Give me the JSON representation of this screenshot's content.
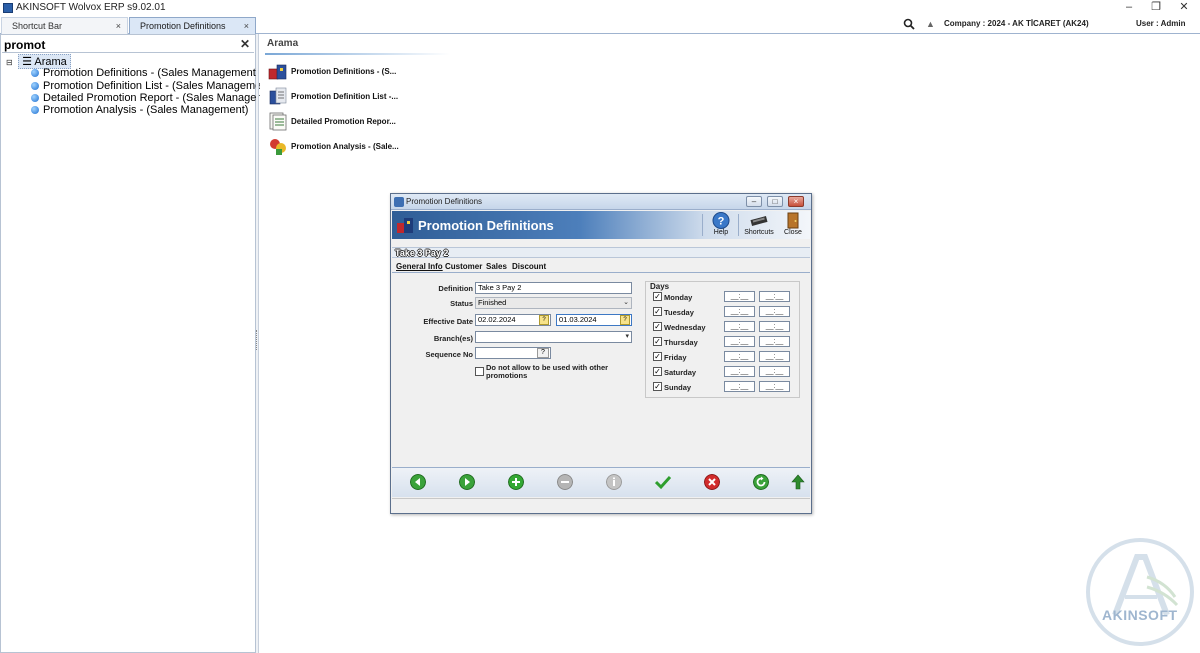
{
  "window": {
    "title": "AKINSOFT Wolvox ERP s9.02.01",
    "minimize": "–",
    "restore": "❐",
    "close": "✕"
  },
  "tabs": [
    {
      "label": "Shortcut Bar",
      "close": "×"
    },
    {
      "label": "Promotion Definitions",
      "close": "×"
    }
  ],
  "topbar": {
    "company": "Company : 2024 - AK TİCARET (AK24)",
    "user": "User : Admin",
    "bell": "▲"
  },
  "left_pane": {
    "search_value": "promot",
    "clear": "✕",
    "tree_root": "Arama",
    "expander": "⊟",
    "items": [
      "Promotion Definitions - (Sales Management)",
      "Promotion Definition List - (Sales Management)",
      "Detailed Promotion Report - (Sales Management)",
      "Promotion Analysis - (Sales Management)"
    ]
  },
  "results": {
    "header": "Arama",
    "items": [
      "Promotion Definitions - (S...",
      "Promotion Definition List -...",
      "Detailed Promotion Repor...",
      "Promotion Analysis - (Sale..."
    ]
  },
  "dialog": {
    "title": "Promotion Definitions",
    "banner_title": "Promotion Definitions",
    "toolbar": {
      "help": "Help",
      "shortcuts": "Shortcuts",
      "close": "Close"
    },
    "record_title": "Take 3 Pay 2",
    "tabs": [
      "General Info",
      "Customer",
      "Sales",
      "Discount"
    ],
    "form": {
      "definition_label": "Definition",
      "definition_value": "Take 3 Pay 2",
      "status_label": "Status",
      "status_value": "Finished",
      "effective_date_label": "Effective Date",
      "date_start": "02.02.2024",
      "date_end": "01.03.2024",
      "branches_label": "Branch(es)",
      "branches_value": "",
      "sequence_label": "Sequence No",
      "sequence_value": "",
      "sequence_btn": "?",
      "no_other_promotions_label": "Do not allow to be used with other promotions",
      "no_other_promotions_checked": false
    },
    "days": {
      "title": "Days",
      "time_placeholder": "__:__",
      "items": [
        {
          "label": "Monday",
          "checked": true
        },
        {
          "label": "Tuesday",
          "checked": true
        },
        {
          "label": "Wednesday",
          "checked": true
        },
        {
          "label": "Thursday",
          "checked": true
        },
        {
          "label": "Friday",
          "checked": true
        },
        {
          "label": "Saturday",
          "checked": true
        },
        {
          "label": "Sunday",
          "checked": true
        }
      ]
    },
    "footer_buttons": [
      {
        "name": "previous",
        "color": "#3aa23a"
      },
      {
        "name": "next",
        "color": "#3aa23a"
      },
      {
        "name": "add",
        "color": "#33a833"
      },
      {
        "name": "delete",
        "color": "#b5b5b5"
      },
      {
        "name": "info",
        "color": "#c4c4c4"
      },
      {
        "name": "save",
        "color": "#2e9e2e"
      },
      {
        "name": "cancel",
        "color": "#d12c2c"
      },
      {
        "name": "refresh",
        "color": "#3aa23a"
      },
      {
        "name": "up",
        "color": "#2e8b2e"
      }
    ]
  },
  "watermark": {
    "text": "AKINSOFT"
  }
}
